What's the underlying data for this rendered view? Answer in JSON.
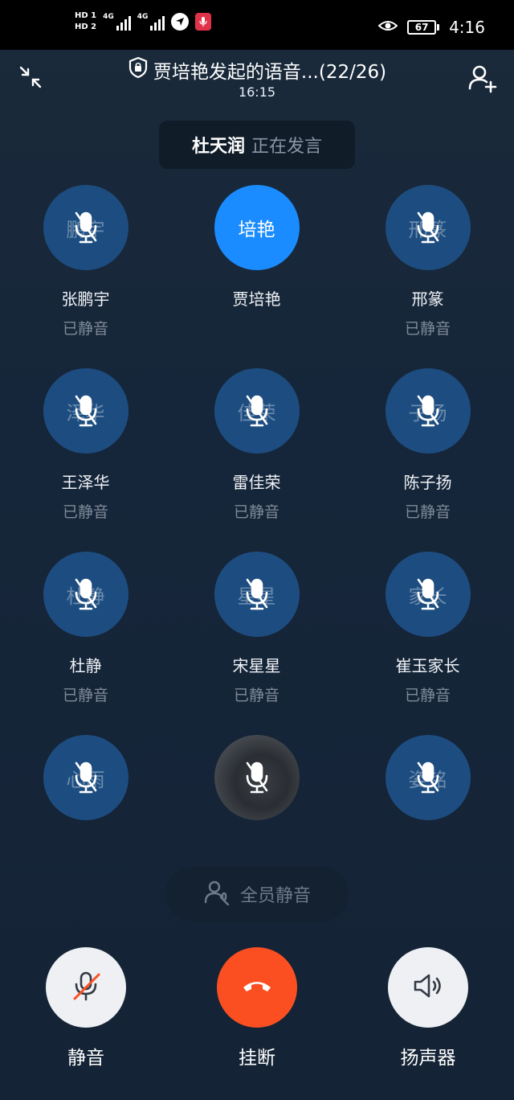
{
  "status_bar": {
    "hd1": "HD 1",
    "hd2": "HD 2",
    "net1": "4G",
    "net2": "4G",
    "battery": "67",
    "time": "4:16"
  },
  "header": {
    "title": "贾培艳发起的语音...(22/26)",
    "call_time": "16:15"
  },
  "speaking": {
    "name": "杜天润",
    "status": "正在发言"
  },
  "participants": [
    {
      "avatar_text": "鹏宇",
      "name": "张鹏宇",
      "status": "已静音",
      "muted": true,
      "active": false,
      "photo": false
    },
    {
      "avatar_text": "培艳",
      "name": "贾培艳",
      "status": "",
      "muted": false,
      "active": true,
      "photo": false
    },
    {
      "avatar_text": "邢篆",
      "name": "邢篆",
      "status": "已静音",
      "muted": true,
      "active": false,
      "photo": false
    },
    {
      "avatar_text": "泽华",
      "name": "王泽华",
      "status": "已静音",
      "muted": true,
      "active": false,
      "photo": false
    },
    {
      "avatar_text": "佳荣",
      "name": "雷佳荣",
      "status": "已静音",
      "muted": true,
      "active": false,
      "photo": false
    },
    {
      "avatar_text": "子扬",
      "name": "陈子扬",
      "status": "已静音",
      "muted": true,
      "active": false,
      "photo": false
    },
    {
      "avatar_text": "杜静",
      "name": "杜静",
      "status": "已静音",
      "muted": true,
      "active": false,
      "photo": false
    },
    {
      "avatar_text": "星星",
      "name": "宋星星",
      "status": "已静音",
      "muted": true,
      "active": false,
      "photo": false
    },
    {
      "avatar_text": "家长",
      "name": "崔玉家长",
      "status": "已静音",
      "muted": true,
      "active": false,
      "photo": false
    },
    {
      "avatar_text": "心雨",
      "name": "",
      "status": "",
      "muted": true,
      "active": false,
      "photo": false
    },
    {
      "avatar_text": "",
      "name": "",
      "status": "",
      "muted": true,
      "active": false,
      "photo": true
    },
    {
      "avatar_text": "姿铭",
      "name": "",
      "status": "",
      "muted": true,
      "active": false,
      "photo": false
    }
  ],
  "mute_all": {
    "label": "全员静音"
  },
  "controls": {
    "mute_label": "静音",
    "hangup_label": "挂断",
    "speaker_label": "扬声器"
  },
  "colors": {
    "active_avatar": "#1a8cff",
    "muted_avatar": "#1d4d80",
    "hangup": "#fb4f22"
  }
}
